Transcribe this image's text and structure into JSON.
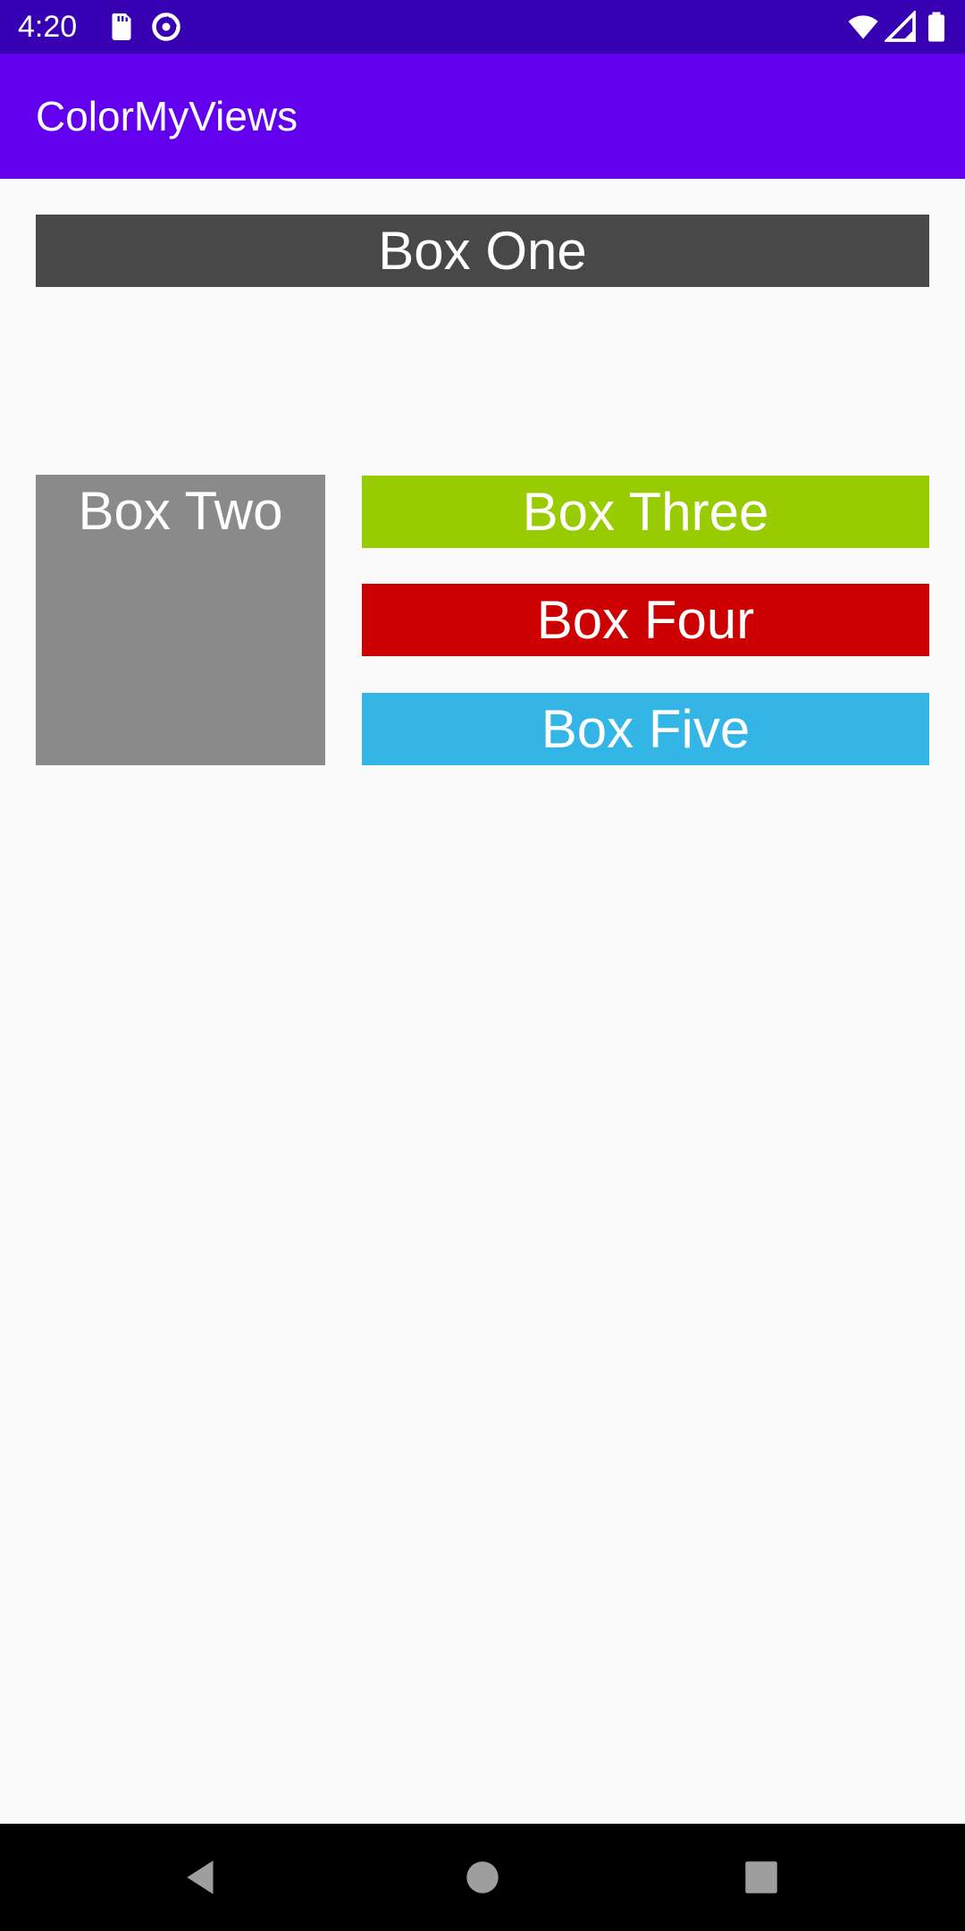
{
  "status_bar": {
    "time": "4:20",
    "background": "#3700b3",
    "icons": [
      "sd-card-icon",
      "data-saver-icon",
      "wifi-icon",
      "signal-icon",
      "battery-icon"
    ]
  },
  "app_bar": {
    "title": "ColorMyViews",
    "background": "#6200ee"
  },
  "boxes": {
    "one": {
      "label": "Box One",
      "color": "#484848"
    },
    "two": {
      "label": "Box Two",
      "color": "#8a8a8a"
    },
    "three": {
      "label": "Box Three",
      "color": "#99cc00"
    },
    "four": {
      "label": "Box Four",
      "color": "#cc0000"
    },
    "five": {
      "label": "Box Five",
      "color": "#33b5e5"
    }
  },
  "nav_bar": {
    "buttons": [
      "back-icon",
      "home-icon",
      "recents-icon"
    ]
  }
}
